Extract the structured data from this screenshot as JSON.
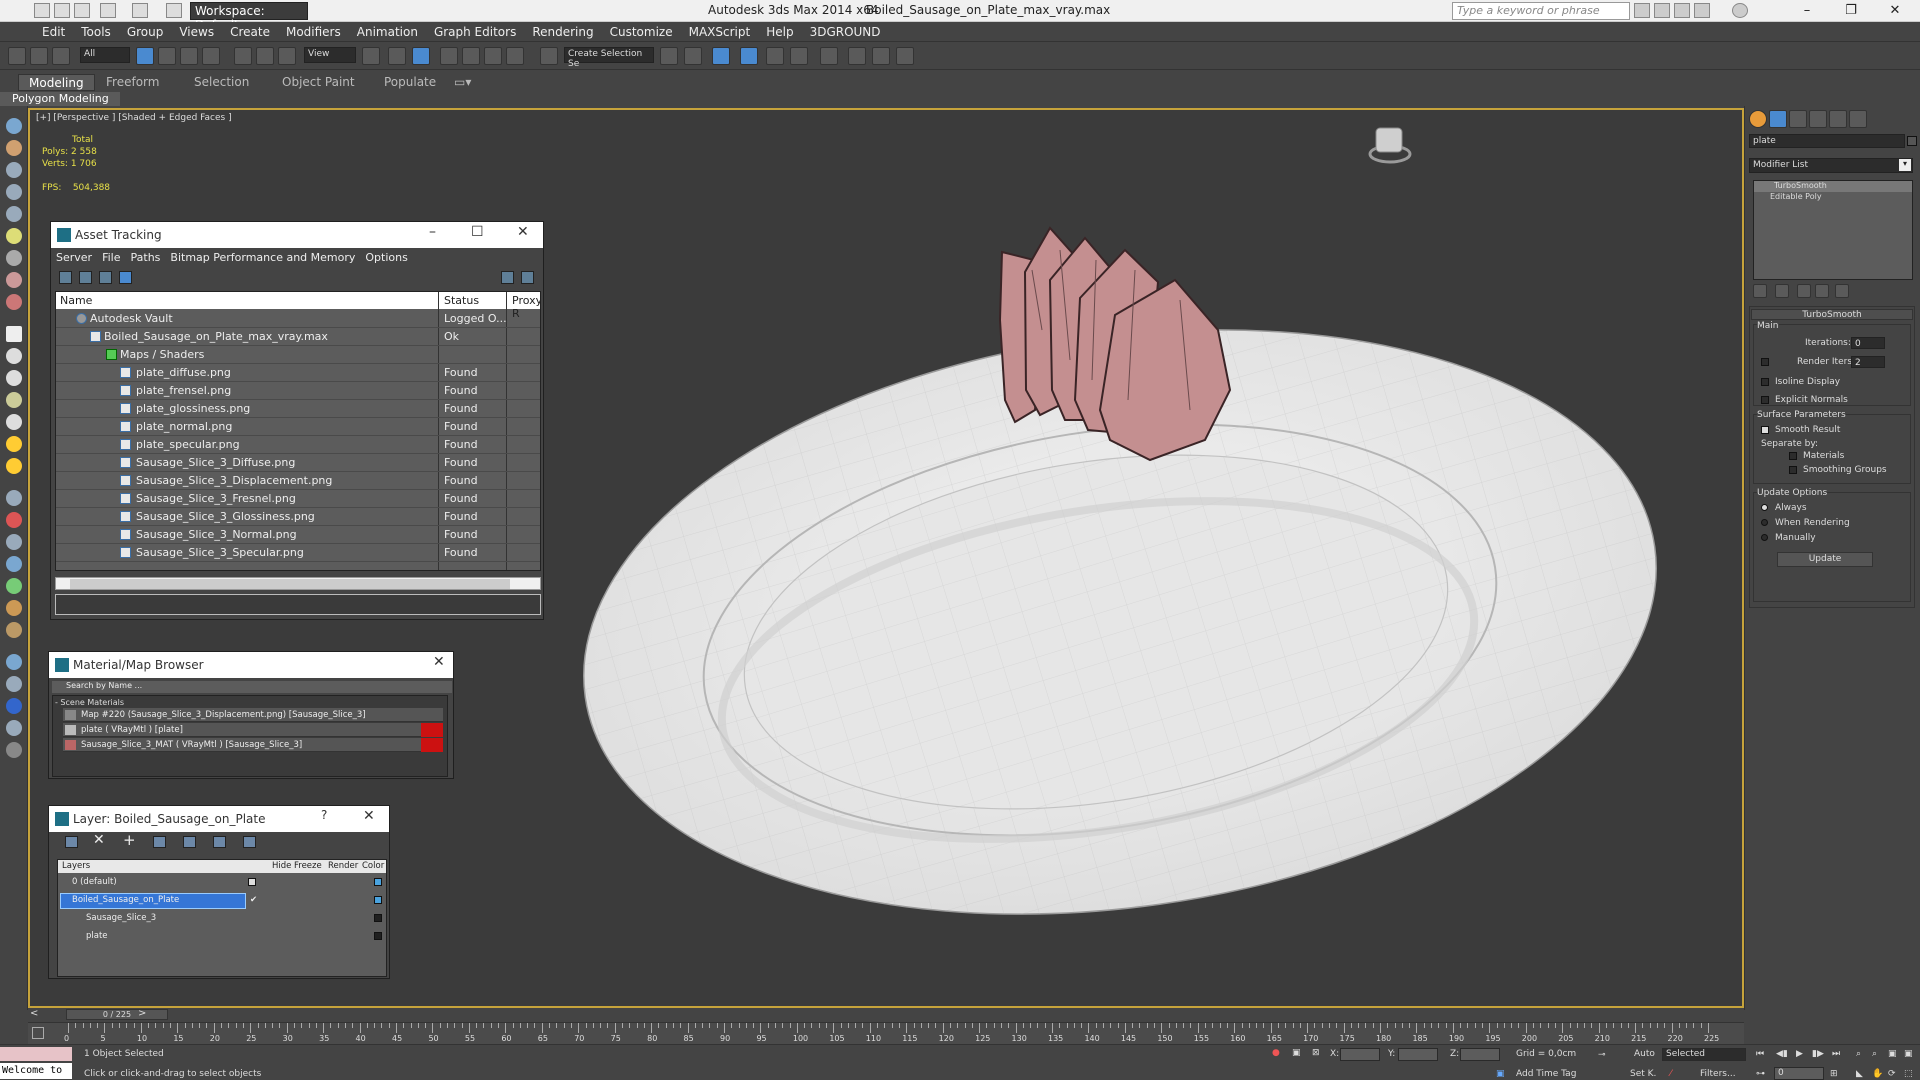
{
  "app": {
    "title": "Autodesk 3ds Max  2014 x64",
    "filename": "Boiled_Sausage_on_Plate_max_vray.max",
    "workspace": "Workspace: Default",
    "search_placeholder": "Type a keyword or phrase"
  },
  "menu": [
    "Edit",
    "Tools",
    "Group",
    "Views",
    "Create",
    "Modifiers",
    "Animation",
    "Graph Editors",
    "Rendering",
    "Customize",
    "MAXScript",
    "Help",
    "3DGROUND"
  ],
  "toolbar": {
    "filter": "All",
    "refcoord": "View",
    "selection_set": "Create Selection Se"
  },
  "ribbon": {
    "tabs": [
      "Modeling",
      "Freeform",
      "Selection",
      "Object Paint",
      "Populate"
    ],
    "active": "Modeling",
    "sub": "Polygon Modeling"
  },
  "viewport": {
    "label": "[+] [Perspective ] [Shaded + Edged Faces ]",
    "stats": {
      "total_label": "Total",
      "polys_label": "Polys:",
      "polys": "2 558",
      "verts_label": "Verts:",
      "verts": "1 706",
      "fps_label": "FPS:",
      "fps": "504,388"
    }
  },
  "asset_tracking": {
    "title": "Asset Tracking",
    "menu": [
      "Server",
      "File",
      "Paths",
      "Bitmap Performance and Memory",
      "Options"
    ],
    "columns": [
      "Name",
      "Status",
      "Proxy R"
    ],
    "rows": [
      {
        "name": "Autodesk Vault",
        "status": "Logged O..."
      },
      {
        "name": "Boiled_Sausage_on_Plate_max_vray.max",
        "status": "Ok"
      },
      {
        "name": "Maps / Shaders",
        "status": ""
      },
      {
        "name": "plate_diffuse.png",
        "status": "Found"
      },
      {
        "name": "plate_frensel.png",
        "status": "Found"
      },
      {
        "name": "plate_glossiness.png",
        "status": "Found"
      },
      {
        "name": "plate_normal.png",
        "status": "Found"
      },
      {
        "name": "plate_specular.png",
        "status": "Found"
      },
      {
        "name": "Sausage_Slice_3_Diffuse.png",
        "status": "Found"
      },
      {
        "name": "Sausage_Slice_3_Displacement.png",
        "status": "Found"
      },
      {
        "name": "Sausage_Slice_3_Fresnel.png",
        "status": "Found"
      },
      {
        "name": "Sausage_Slice_3_Glossiness.png",
        "status": "Found"
      },
      {
        "name": "Sausage_Slice_3_Normal.png",
        "status": "Found"
      },
      {
        "name": "Sausage_Slice_3_Specular.png",
        "status": "Found"
      }
    ]
  },
  "material_browser": {
    "title": "Material/Map Browser",
    "search_placeholder": "Search by Name ...",
    "group": "- Scene Materials",
    "items": [
      "Map #220 (Sausage_Slice_3_Displacement.png) [Sausage_Slice_3]",
      "plate  ( VRayMtl )  [plate]",
      "Sausage_Slice_3_MAT  ( VRayMtl )  [Sausage_Slice_3]"
    ]
  },
  "layer_window": {
    "title": "Layer: Boiled_Sausage_on_Plate",
    "help": "?",
    "columns": [
      "Layers",
      "Hide",
      "Freeze",
      "Render",
      "Color"
    ],
    "rows": [
      {
        "name": "0 (default)",
        "color": "#4aa3df"
      },
      {
        "name": "Boiled_Sausage_on_Plate",
        "color": "#4aa3df",
        "selected": true
      },
      {
        "name": "Sausage_Slice_3",
        "color": "#202020"
      },
      {
        "name": "plate",
        "color": "#202020"
      }
    ]
  },
  "command_panel": {
    "object_name": "plate",
    "modifier_list": "Modifier List",
    "stack": [
      "TurboSmooth",
      "Editable Poly"
    ],
    "rollout_title": "TurboSmooth",
    "main": "Main",
    "iterations_label": "Iterations:",
    "iterations": "0",
    "render_iters_label": "Render Iters:",
    "render_iters": "2",
    "isoline": "Isoline Display",
    "explicit": "Explicit Normals",
    "surface": "Surface Parameters",
    "smooth_result": "Smooth Result",
    "separate_by": "Separate by:",
    "materials": "Materials",
    "smoothing_groups": "Smoothing Groups",
    "update_options": "Update Options",
    "always": "Always",
    "when_rendering": "When Rendering",
    "manually": "Manually",
    "update_btn": "Update"
  },
  "timeline": {
    "slider": "0 / 225",
    "ticks": [
      "0",
      "5",
      "10",
      "15",
      "20",
      "25",
      "30",
      "35",
      "40",
      "45",
      "50",
      "55",
      "60",
      "65",
      "70",
      "75",
      "80",
      "85",
      "90",
      "95",
      "100",
      "105",
      "110",
      "115",
      "120",
      "125",
      "130",
      "135",
      "140",
      "145",
      "150",
      "155",
      "160",
      "165",
      "170",
      "175",
      "180",
      "185",
      "190",
      "195",
      "200",
      "205",
      "210",
      "215",
      "220",
      "225"
    ]
  },
  "status": {
    "welcome": "Welcome to",
    "selected": "1 Object Selected",
    "prompt": "Click or click-and-drag to select objects",
    "x_label": "X:",
    "y_label": "Y:",
    "z_label": "Z:",
    "grid": "Grid = 0,0cm",
    "add_time_tag": "Add Time Tag",
    "auto": "Auto",
    "set_key": "Set K.",
    "selected_dd": "Selected",
    "filters": "Filters...",
    "frame": "0"
  }
}
